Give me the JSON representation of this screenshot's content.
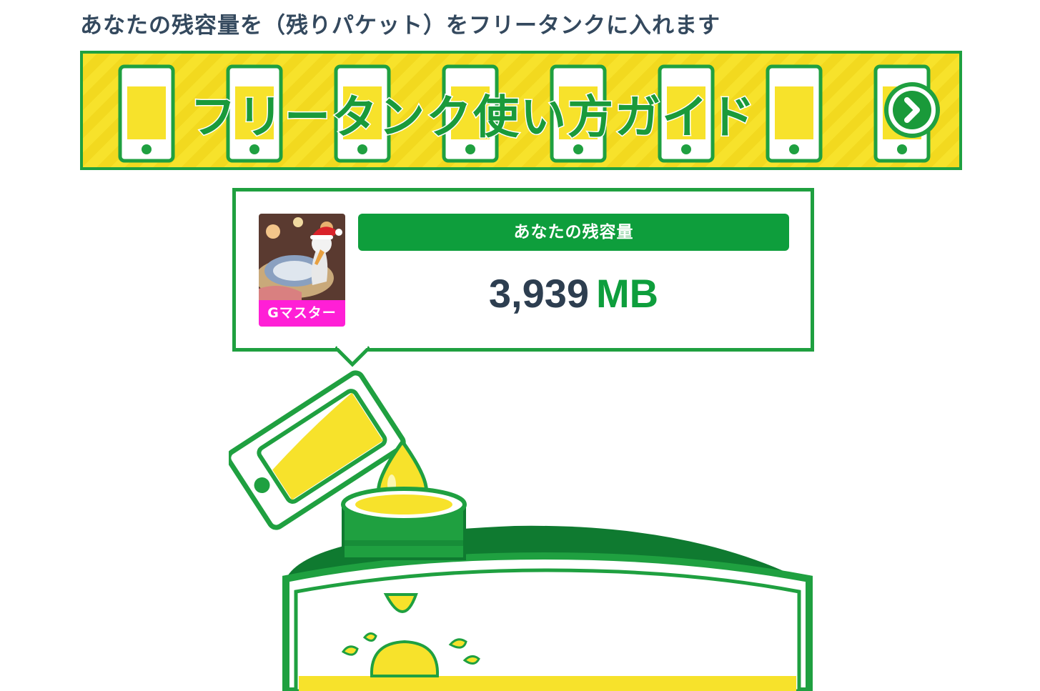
{
  "intro_text": "あなたの残容量を（残りパケット）をフリータンクに入れます",
  "banner": {
    "title": "フリータンク使い方ガイド",
    "arrow_icon": "chevron-right-icon",
    "colors": {
      "background": "#f7e22b",
      "border": "#1fa040",
      "text": "#1a9a3a"
    }
  },
  "balance_card": {
    "label": "あなたの残容量",
    "value": "3,939",
    "unit": "MB",
    "avatar": {
      "badge": "Gマスター"
    },
    "colors": {
      "accent": "#0e9e3c",
      "badge": "#ff1fd6",
      "value_text": "#2d3e50"
    }
  },
  "illustration": {
    "icons": [
      "smartphone-icon",
      "droplet-icon",
      "tank-icon"
    ]
  }
}
